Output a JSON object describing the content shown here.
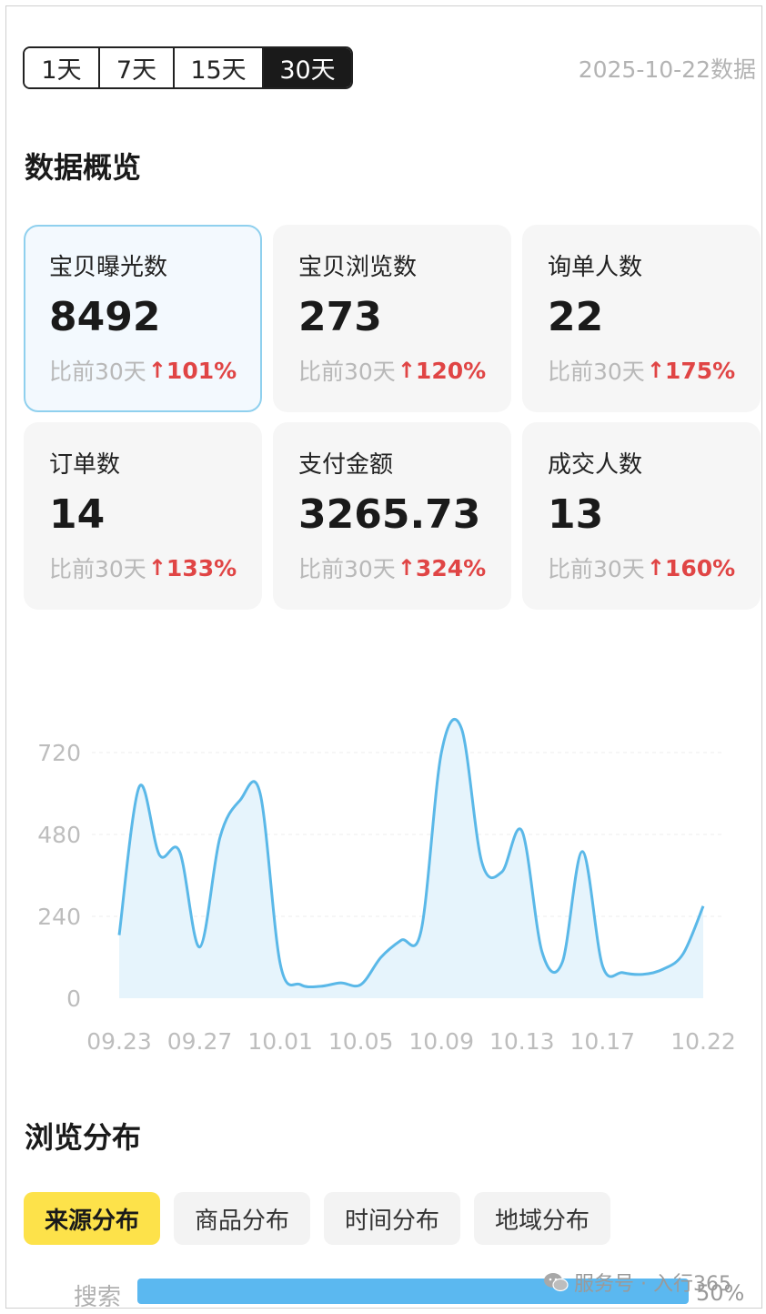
{
  "range_selector": {
    "options": [
      "1天",
      "7天",
      "15天",
      "30天"
    ],
    "selected": "30天"
  },
  "date_note": "2025-10-22数据",
  "overview": {
    "title": "数据概览",
    "cards": [
      {
        "label": "宝贝曝光数",
        "value": "8492",
        "compare": "比前30天",
        "change": "101%",
        "selected": true
      },
      {
        "label": "宝贝浏览数",
        "value": "273",
        "compare": "比前30天",
        "change": "120%",
        "selected": false
      },
      {
        "label": "询单人数",
        "value": "22",
        "compare": "比前30天",
        "change": "175%",
        "selected": false
      },
      {
        "label": "订单数",
        "value": "14",
        "compare": "比前30天",
        "change": "133%",
        "selected": false
      },
      {
        "label": "支付金额",
        "value": "3265.73",
        "compare": "比前30天",
        "change": "324%",
        "selected": false
      },
      {
        "label": "成交人数",
        "value": "13",
        "compare": "比前30天",
        "change": "160%",
        "selected": false
      }
    ]
  },
  "colors": {
    "accent_up": "#e04545",
    "line": "#5ab8e8",
    "area": "#e6f4fc",
    "active_tab": "#fde24a",
    "bar": "#5bb8f0"
  },
  "chart_data": {
    "type": "area",
    "title": "",
    "xlabel": "",
    "ylabel": "",
    "x": [
      "09.23",
      "09.24",
      "09.25",
      "09.26",
      "09.27",
      "09.28",
      "09.29",
      "09.30",
      "10.01",
      "10.02",
      "10.03",
      "10.04",
      "10.05",
      "10.06",
      "10.07",
      "10.08",
      "10.09",
      "10.10",
      "10.11",
      "10.12",
      "10.13",
      "10.14",
      "10.15",
      "10.16",
      "10.17",
      "10.18",
      "10.19",
      "10.20",
      "10.21",
      "10.22"
    ],
    "series": [
      {
        "name": "",
        "values": [
          185,
          620,
          420,
          430,
          150,
          470,
          580,
          600,
          100,
          40,
          35,
          45,
          40,
          120,
          170,
          200,
          720,
          790,
          400,
          370,
          490,
          135,
          105,
          430,
          95,
          75,
          70,
          85,
          130,
          270
        ]
      }
    ],
    "x_ticks": [
      "09.23",
      "09.27",
      "10.01",
      "10.05",
      "10.09",
      "10.13",
      "10.17",
      "10.22"
    ],
    "y_ticks": [
      0,
      240,
      480,
      720
    ],
    "ylim": [
      0,
      800
    ],
    "grid": true,
    "legend": "none"
  },
  "distribution": {
    "title": "浏览分布",
    "tabs": [
      "来源分布",
      "商品分布",
      "时间分布",
      "地域分布"
    ],
    "active_tab": "来源分布",
    "rows": [
      {
        "label": "搜索",
        "percent": 50,
        "percent_text": "50%"
      }
    ]
  },
  "watermark": {
    "icon": "wechat-icon",
    "text": "服务号 · 入行365"
  }
}
